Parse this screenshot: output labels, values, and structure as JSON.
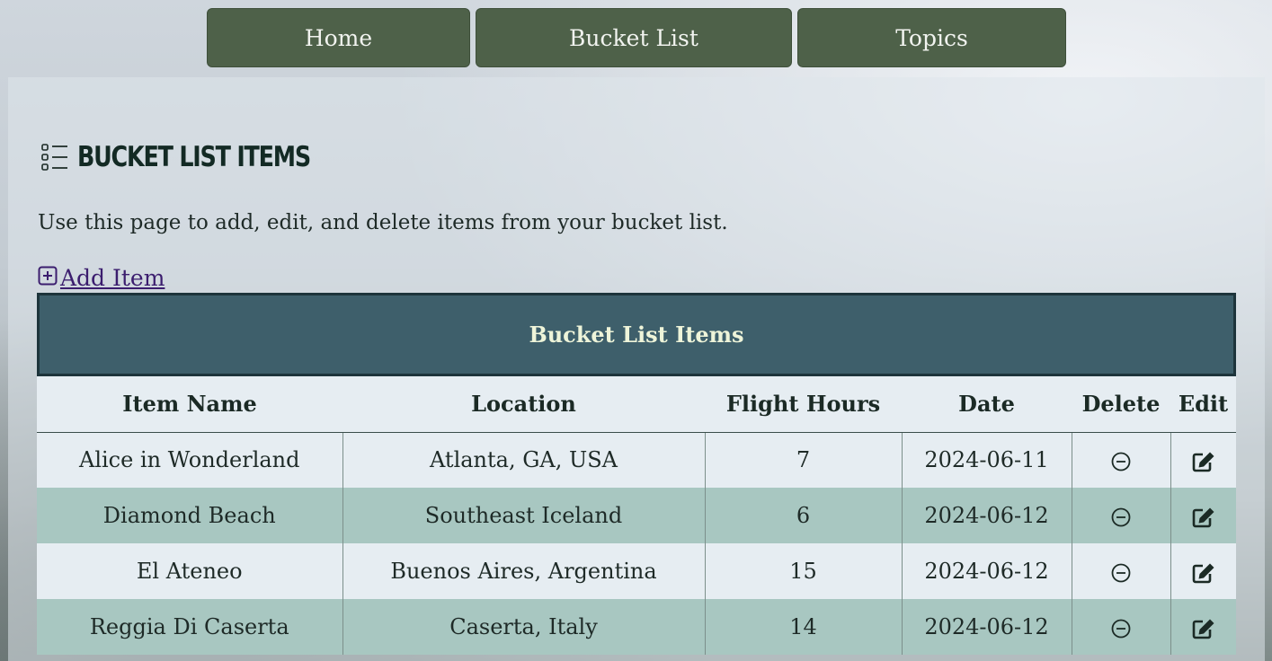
{
  "nav": {
    "home": "Home",
    "bucket_list": "Bucket List",
    "topics": "Topics"
  },
  "page": {
    "title": "Bucket List Items",
    "intro": "Use this page to add, edit, and delete items from your bucket list.",
    "add_item": "Add Item"
  },
  "table": {
    "caption": "Bucket List Items",
    "headers": [
      "Item Name",
      "Location",
      "Flight Hours",
      "Date",
      "Delete",
      "Edit"
    ],
    "rows": [
      {
        "name": "Alice in Wonderland",
        "location": "Atlanta, GA, USA",
        "hours": "7",
        "date": "2024-06-11"
      },
      {
        "name": "Diamond Beach",
        "location": "Southeast Iceland",
        "hours": "6",
        "date": "2024-06-12"
      },
      {
        "name": "El Ateneo",
        "location": "Buenos Aires, Argentina",
        "hours": "15",
        "date": "2024-06-12"
      },
      {
        "name": "Reggia Di Caserta",
        "location": "Caserta, Italy",
        "hours": "14",
        "date": "2024-06-12"
      }
    ],
    "delete_icon": "minus-circle-icon",
    "edit_icon": "edit-square-icon"
  },
  "colors": {
    "nav_button": "#4e6149",
    "caption_bg": "#3e5f6b",
    "row_alt": "#a8c7c1",
    "row_base": "#e6edf2"
  }
}
